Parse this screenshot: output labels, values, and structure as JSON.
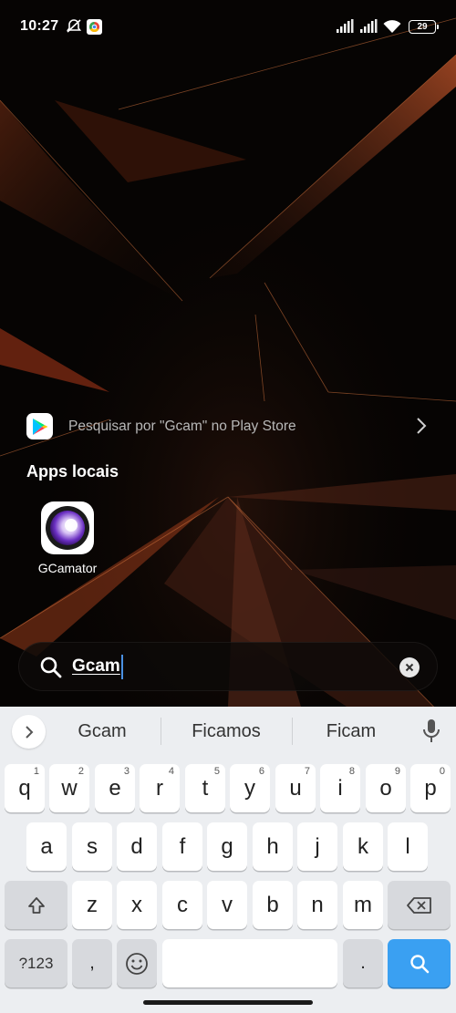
{
  "status_bar": {
    "time": "10:27",
    "battery": "29",
    "icons": [
      "mute-icon",
      "chrome-icon",
      "signal-icon",
      "signal-icon",
      "wifi-icon",
      "battery-icon"
    ]
  },
  "play_suggestion": {
    "text": "Pesquisar por \"Gcam\" no Play Store",
    "icon": "play-store-icon"
  },
  "local_apps": {
    "title": "Apps locais",
    "apps": [
      {
        "label": "GCamator",
        "icon": "gcamator-app-icon"
      }
    ]
  },
  "search": {
    "value": "Gcam"
  },
  "keyboard": {
    "suggestions": [
      "Gcam",
      "Ficamos",
      "Ficam"
    ],
    "row1": [
      {
        "label": "q",
        "hint": "1"
      },
      {
        "label": "w",
        "hint": "2"
      },
      {
        "label": "e",
        "hint": "3"
      },
      {
        "label": "r",
        "hint": "4"
      },
      {
        "label": "t",
        "hint": "5"
      },
      {
        "label": "y",
        "hint": "6"
      },
      {
        "label": "u",
        "hint": "7"
      },
      {
        "label": "i",
        "hint": "8"
      },
      {
        "label": "o",
        "hint": "9"
      },
      {
        "label": "p",
        "hint": "0"
      }
    ],
    "row2": [
      "a",
      "s",
      "d",
      "f",
      "g",
      "h",
      "j",
      "k",
      "l"
    ],
    "row3": [
      "z",
      "x",
      "c",
      "v",
      "b",
      "n",
      "m"
    ],
    "symbols_label": "?123",
    "comma_label": ",",
    "period_label": ".",
    "colors": {
      "accent": "#3aa0f2",
      "key_bg": "#ffffff",
      "keyboard_bg": "#eceef1"
    }
  }
}
